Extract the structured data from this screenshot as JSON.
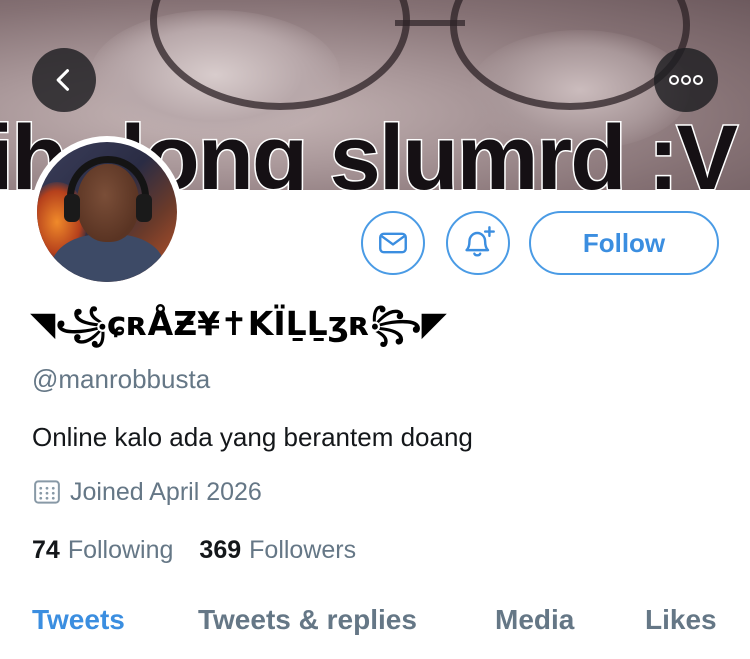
{
  "banner": {
    "caption": "ih dong slumrd :V"
  },
  "header": {
    "back_icon": "chevron-left-icon",
    "more_icon": "more-horizontal-icon"
  },
  "actions": {
    "message_icon": "envelope-icon",
    "notify_icon": "bell-plus-icon",
    "follow_label": "Follow",
    "accent_color": "#3b8ee0"
  },
  "profile": {
    "display_name": "◥꧁ɕʀÅƵ¥✝KÏḺḺʒʀ꧂◤",
    "handle": "@manrobbusta",
    "bio": "Online kalo ada yang berantem doang",
    "joined": "Joined April 2026",
    "calendar_icon": "calendar-icon"
  },
  "stats": {
    "following_count": "74",
    "following_label": "Following",
    "followers_count": "369",
    "followers_label": "Followers"
  },
  "tabs": [
    {
      "label": "Tweets",
      "active": true
    },
    {
      "label": "Tweets & replies",
      "active": false
    },
    {
      "label": "Media",
      "active": false
    },
    {
      "label": "Likes",
      "active": false
    }
  ]
}
